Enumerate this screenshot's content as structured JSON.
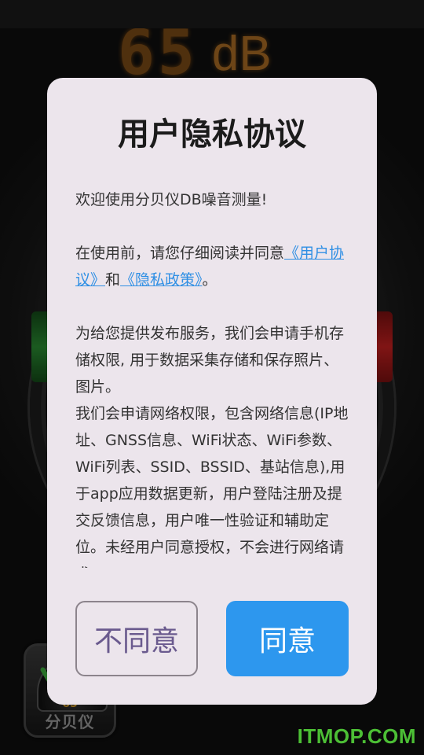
{
  "background": {
    "meter_digits": "65",
    "meter_unit": "dB",
    "dock_value": "65",
    "dock_label": "分贝仪",
    "watermark": "ITMOP.COM"
  },
  "dialog": {
    "title": "用户隐私协议",
    "welcome": "欢迎使用分贝仪DB噪音测量!",
    "intro_before": "在使用前，请您仔细阅读并同意",
    "user_agreement_link": "《用户协议》",
    "intro_and": "和",
    "privacy_policy_link": "《隐私政策》",
    "intro_end": "。",
    "storage_permission": "为给您提供发布服务，我们会申请手机存储权限, 用于数据采集存储和保存照片、图片。",
    "network_permission": "我们会申请网络权限，包含网络信息(IP地址、GNSS信息、WiFi状态、WiFi参数、WiFi列表、SSID、BSSID、基站信息),用于app应用数据更新，用户登陆注册及提交反馈信息，用户唯一性验证和辅助定位。未经用户同意授权，不会进行网络请求",
    "disagree_button": "不同意",
    "agree_button": "同意"
  },
  "colors": {
    "dialog_bg": "#ece5ec",
    "link": "#2f8fe4",
    "agree_button": "#2d97ee",
    "disagree_text": "#6a5a8e",
    "watermark": "#4cbf35"
  }
}
